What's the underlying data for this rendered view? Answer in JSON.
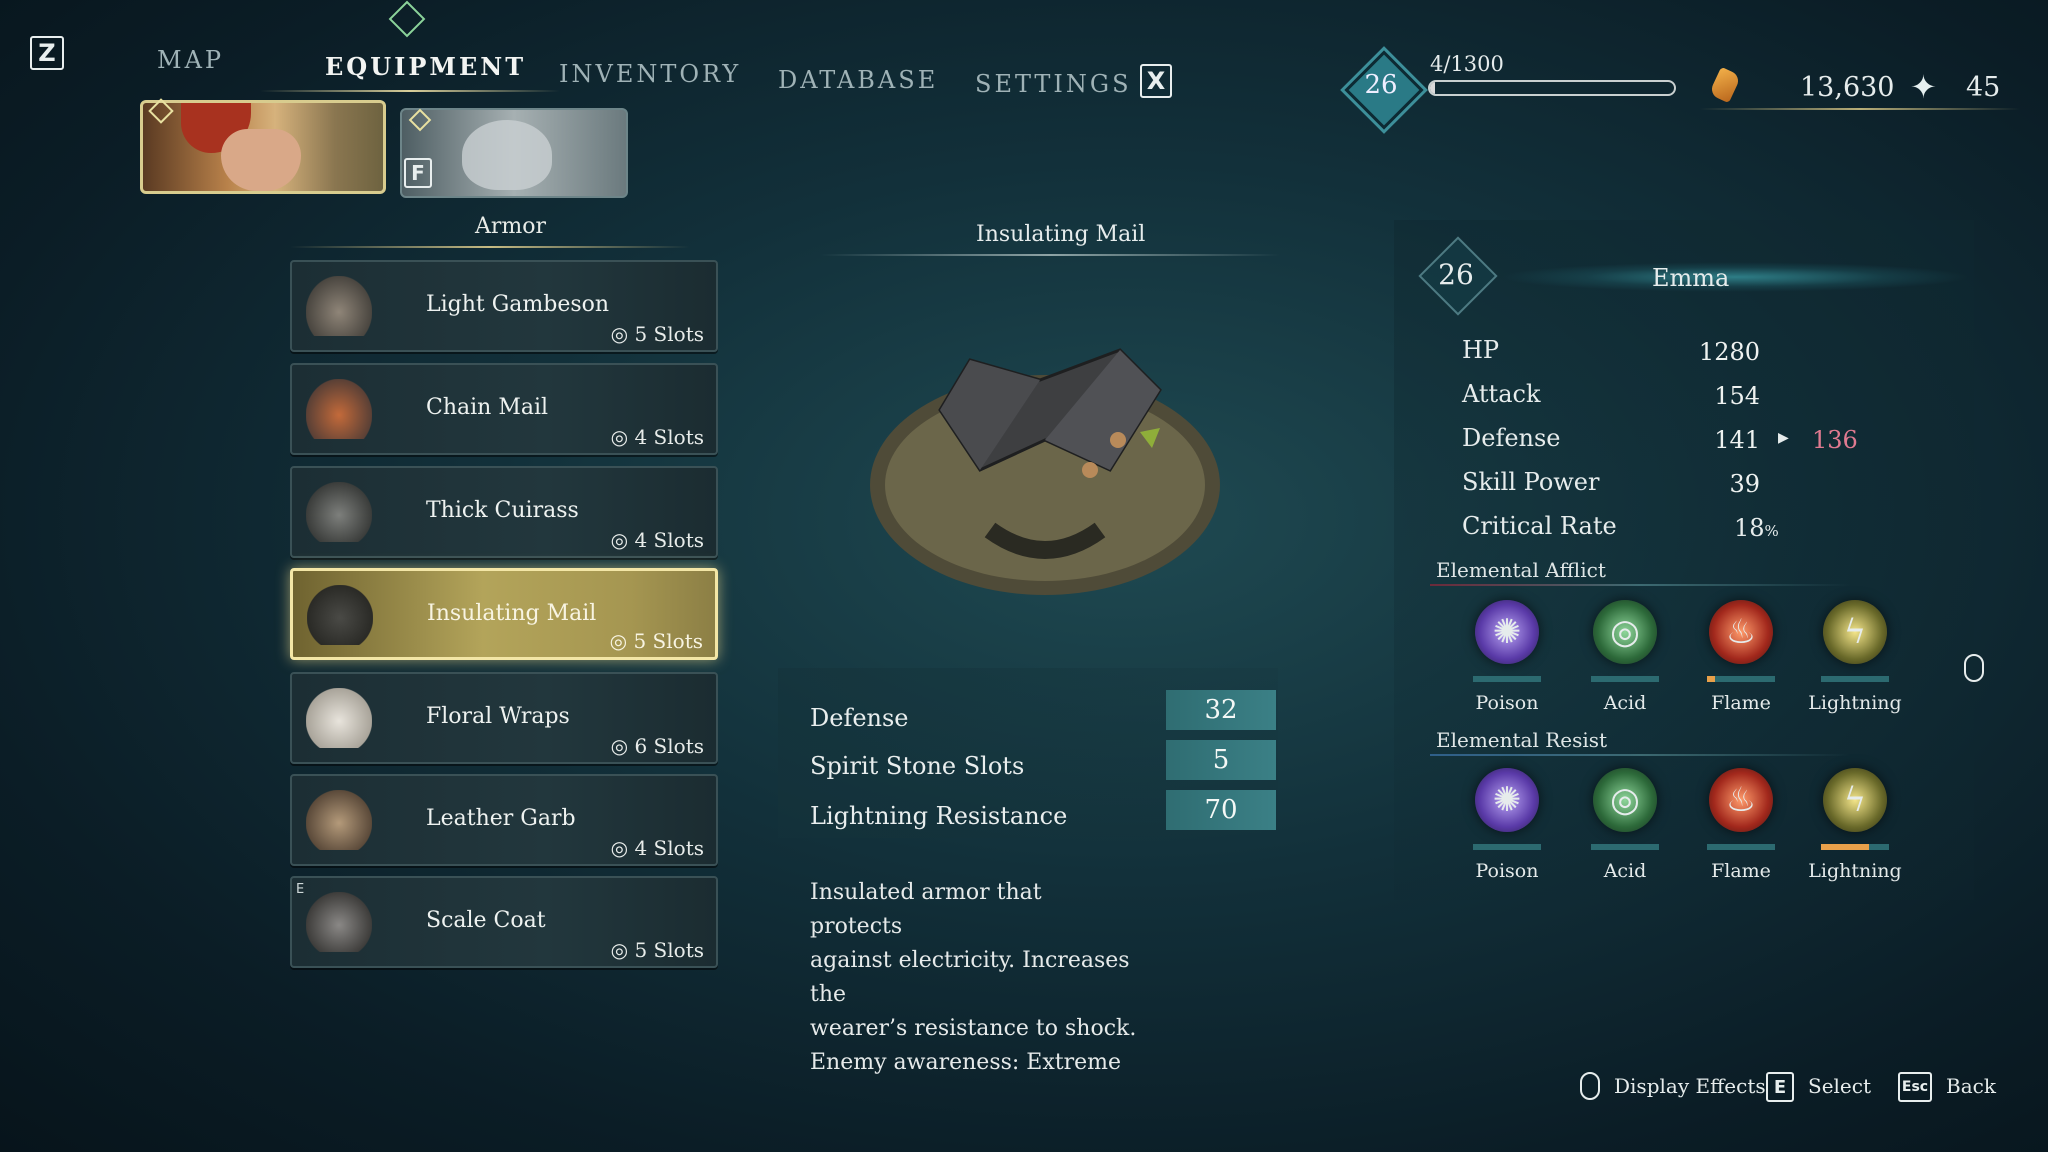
{
  "keys": {
    "z": "Z",
    "x": "X",
    "f": "F"
  },
  "tabs": [
    "MAP",
    "EQUIPMENT",
    "INVENTORY",
    "DATABASE",
    "SETTINGS"
  ],
  "header": {
    "level": "26",
    "exp_text": "4/1300",
    "exp_progress": 0.003,
    "currency": "13,630",
    "spirit": "45"
  },
  "armor": {
    "title": "Armor",
    "items": [
      {
        "name": "Light Gambeson",
        "slots": "5 Slots",
        "icon": "gambeson-icon"
      },
      {
        "name": "Chain Mail",
        "slots": "4 Slots",
        "icon": "chain-mail-icon"
      },
      {
        "name": "Thick Cuirass",
        "slots": "4 Slots",
        "icon": "cuirass-icon"
      },
      {
        "name": "Insulating Mail",
        "slots": "5 Slots",
        "icon": "insulating-mail-icon",
        "selected": true
      },
      {
        "name": "Floral Wraps",
        "slots": "6 Slots",
        "icon": "floral-wraps-icon"
      },
      {
        "name": "Leather Garb",
        "slots": "4 Slots",
        "icon": "leather-garb-icon"
      },
      {
        "name": "Scale Coat",
        "slots": "5 Slots",
        "icon": "scale-coat-icon",
        "badge": "E"
      }
    ]
  },
  "detail": {
    "title": "Insulating Mail",
    "stats": [
      {
        "label": "Defense",
        "value": "32"
      },
      {
        "label": "Spirit Stone Slots",
        "value": "5"
      },
      {
        "label": "Lightning Resistance",
        "value": "70"
      }
    ],
    "description": [
      "Insulated armor that protects",
      "against electricity. Increases the",
      "wearer’s resistance to shock.",
      "Enemy awareness: Extreme"
    ]
  },
  "character": {
    "level": "26",
    "name": "Emma",
    "stats": [
      {
        "label": "HP",
        "value": "1280"
      },
      {
        "label": "Attack",
        "value": "154"
      },
      {
        "label": "Defense",
        "value": "141",
        "new_value": "136"
      },
      {
        "label": "Skill Power",
        "value": "39"
      },
      {
        "label": "Critical Rate",
        "value": "18",
        "unit": "%"
      }
    ],
    "afflict_title": "Elemental Afflict",
    "resist_title": "Elemental Resist",
    "afflict": [
      {
        "label": "Poison",
        "level": 0.0
      },
      {
        "label": "Acid",
        "level": 0.0
      },
      {
        "label": "Flame",
        "level": 0.12
      },
      {
        "label": "Lightning",
        "level": 0.0
      }
    ],
    "resist": [
      {
        "label": "Poison",
        "level": 0.0
      },
      {
        "label": "Acid",
        "level": 0.0
      },
      {
        "label": "Flame",
        "level": 0.0
      },
      {
        "label": "Lightning",
        "level": 0.7
      }
    ]
  },
  "hints": {
    "display_effects": "Display Effects",
    "select_key": "E",
    "select": "Select",
    "back_key": "Esc",
    "back": "Back"
  },
  "colors": {
    "accent_teal": "#3b8086",
    "highlight_gold": "#b3a45a",
    "decrease_red": "#e07a90",
    "bar_orange": "#e8a04a"
  }
}
